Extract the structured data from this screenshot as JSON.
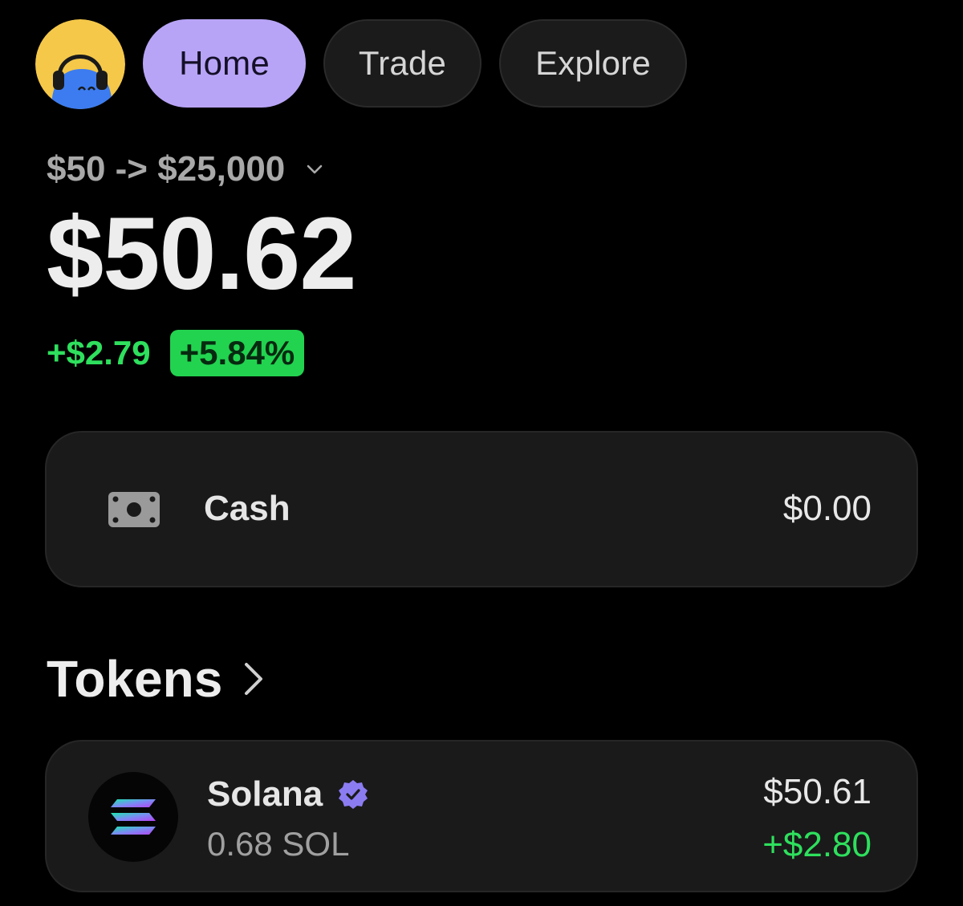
{
  "nav": {
    "home_label": "Home",
    "trade_label": "Trade",
    "explore_label": "Explore",
    "avatar_icon": "avatar-headphones-character"
  },
  "portfolio": {
    "account_name": "$50 -> $25,000",
    "balance": "$50.62",
    "change_amount": "+$2.79",
    "change_percent": "+5.84%"
  },
  "cash": {
    "label": "Cash",
    "value": "$0.00",
    "icon": "cash-bill-icon"
  },
  "tokens": {
    "title": "Tokens",
    "items": [
      {
        "name": "Solana",
        "amount": "0.68 SOL",
        "value": "$50.61",
        "change": "+$2.80",
        "verified": true,
        "icon": "solana-logo-icon"
      }
    ]
  },
  "colors": {
    "background": "#000000",
    "accent_purple": "#b8a4f7",
    "positive_green": "#2ee05d",
    "badge_green": "#22d34f",
    "card_bg": "#1a1a1a"
  }
}
